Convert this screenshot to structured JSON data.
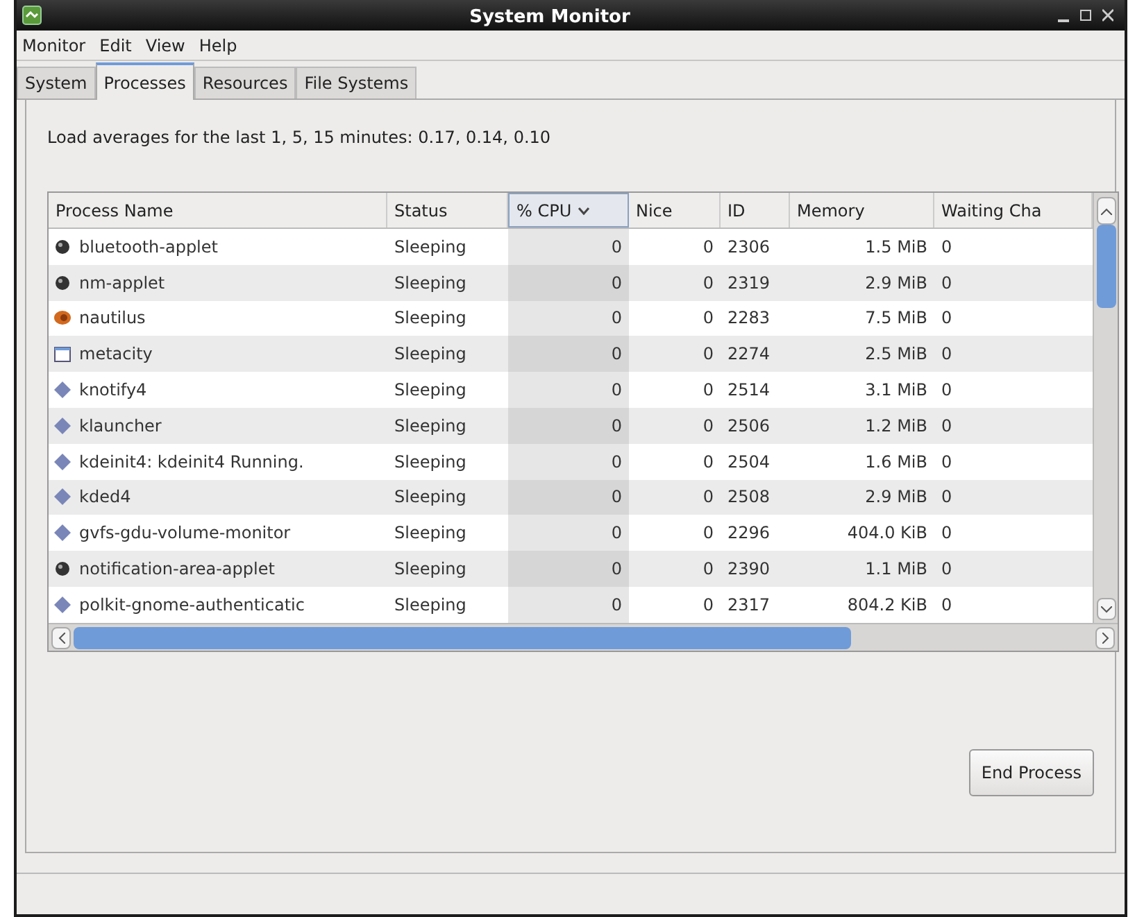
{
  "window": {
    "title": "System Monitor"
  },
  "menu": [
    {
      "label": "Monitor"
    },
    {
      "label": "Edit"
    },
    {
      "label": "View"
    },
    {
      "label": "Help"
    }
  ],
  "tabs": [
    {
      "label": "System",
      "selected": false
    },
    {
      "label": "Processes",
      "selected": true
    },
    {
      "label": "Resources",
      "selected": false
    },
    {
      "label": "File Systems",
      "selected": false
    }
  ],
  "load_averages": "Load averages for the last 1, 5, 15 minutes: 0.17, 0.14, 0.10",
  "table": {
    "columns": [
      {
        "label": "Process Name",
        "sorted": false
      },
      {
        "label": "Status",
        "sorted": false
      },
      {
        "label": "% CPU",
        "sorted": true
      },
      {
        "label": "Nice",
        "sorted": false
      },
      {
        "label": "ID",
        "sorted": false
      },
      {
        "label": "Memory",
        "sorted": false
      },
      {
        "label": "Waiting Cha",
        "sorted": false
      }
    ],
    "rows": [
      {
        "kind": "ball",
        "cells": [
          "bluetooth-applet",
          "Sleeping",
          "0",
          "0",
          "2306",
          "1.5 MiB",
          "0"
        ]
      },
      {
        "kind": "ball",
        "cells": [
          "nm-applet",
          "Sleeping",
          "0",
          "0",
          "2319",
          "2.9 MiB",
          "0"
        ]
      },
      {
        "kind": "shell",
        "cells": [
          "nautilus",
          "Sleeping",
          "0",
          "0",
          "2283",
          "7.5 MiB",
          "0"
        ]
      },
      {
        "kind": "window",
        "cells": [
          "metacity",
          "Sleeping",
          "0",
          "0",
          "2274",
          "2.5 MiB",
          "0"
        ]
      },
      {
        "kind": "diamond",
        "cells": [
          "knotify4",
          "Sleeping",
          "0",
          "0",
          "2514",
          "3.1 MiB",
          "0"
        ]
      },
      {
        "kind": "diamond",
        "cells": [
          "klauncher",
          "Sleeping",
          "0",
          "0",
          "2506",
          "1.2 MiB",
          "0"
        ]
      },
      {
        "kind": "diamond",
        "cells": [
          "kdeinit4: kdeinit4 Running.",
          "Sleeping",
          "0",
          "0",
          "2504",
          "1.6 MiB",
          "0"
        ]
      },
      {
        "kind": "diamond",
        "cells": [
          "kded4",
          "Sleeping",
          "0",
          "0",
          "2508",
          "2.9 MiB",
          "0"
        ]
      },
      {
        "kind": "diamond",
        "cells": [
          "gvfs-gdu-volume-monitor",
          "Sleeping",
          "0",
          "0",
          "2296",
          "404.0 KiB",
          "0"
        ]
      },
      {
        "kind": "ball",
        "cells": [
          "notification-area-applet",
          "Sleeping",
          "0",
          "0",
          "2390",
          "1.1 MiB",
          "0"
        ]
      },
      {
        "kind": "diamond",
        "cells": [
          "polkit-gnome-authenticatic",
          "Sleeping",
          "0",
          "0",
          "2317",
          "804.2 KiB",
          "0"
        ]
      }
    ]
  },
  "end_button": {
    "label": "End Process"
  }
}
